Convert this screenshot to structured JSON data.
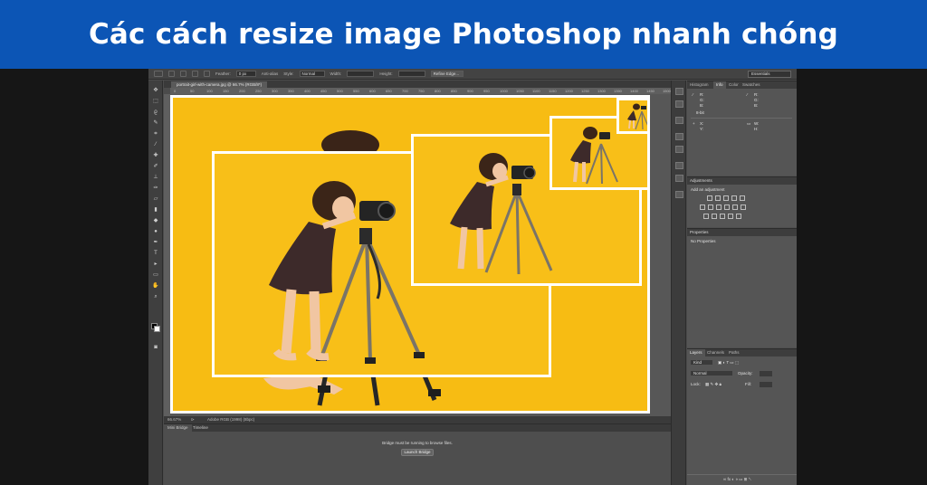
{
  "banner": {
    "title": "Các cách resize image Photoshop nhanh chóng"
  },
  "colors": {
    "banner_bg": "#0c55b5",
    "backdrop": "#f7bc13",
    "frame": "#ffffff",
    "ui_bg": "#4b4b4b"
  },
  "options_bar": {
    "feather_label": "Feather:",
    "feather_value": "0 px",
    "antialias_label": "Anti-alias",
    "style_label": "Style:",
    "style_value": "Normal",
    "width_label": "Width:",
    "height_label": "Height:",
    "refine_edge": "Refine Edge...",
    "workspace": "Essentials"
  },
  "document": {
    "tab_label": "portrait-girl-with-camera.jpg @ 66.7% (RGB/8*)",
    "ruler_marks": [
      "0",
      "50",
      "100",
      "150",
      "200",
      "250",
      "300",
      "350",
      "400",
      "450",
      "500",
      "550",
      "600",
      "650",
      "700",
      "750",
      "800",
      "850",
      "900",
      "950",
      "1000",
      "1050",
      "1100",
      "1150",
      "1200",
      "1250",
      "1300",
      "1350",
      "1400",
      "1450",
      "1500"
    ]
  },
  "status_bar": {
    "zoom": "66.67%",
    "profile": "Adobe RGB (1998) (8bpc)"
  },
  "mini_bridge": {
    "tabs": [
      "Mini Bridge",
      "Timeline"
    ],
    "message": "Bridge must be running to browse files.",
    "button": "Launch Bridge"
  },
  "panels": {
    "info_tabs": [
      "Histogram",
      "Info",
      "Color",
      "Swatches"
    ],
    "info_labels": [
      "R:",
      "G:",
      "B:",
      "8-bit",
      "X:",
      "Y:",
      "W:",
      "H:"
    ],
    "adjustments": {
      "title": "Adjustments",
      "subtitle": "Add an adjustment"
    },
    "properties": {
      "title": "Properties",
      "subtitle": "No Properties"
    },
    "layers": {
      "tabs": [
        "Layers",
        "Channels",
        "Paths"
      ],
      "kind": "Kind",
      "blend": "Normal",
      "opacity_label": "Opacity:",
      "lock_label": "Lock:",
      "fill_label": "Fill:"
    }
  }
}
